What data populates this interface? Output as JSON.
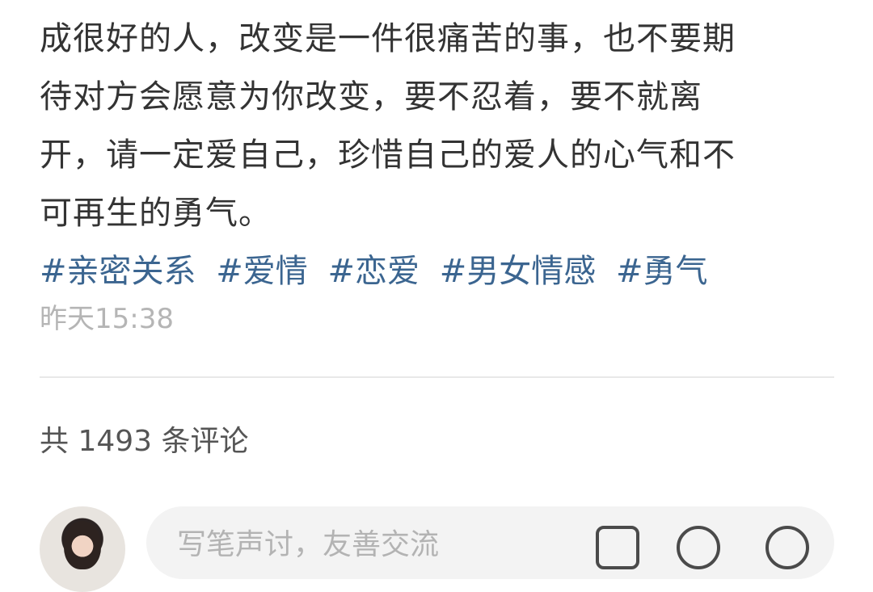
{
  "post": {
    "lines": [
      "成很好的人，改变是一件很痛苦的事，也不要期",
      "待对方会愿意为你改变，要不忍着，要不就离",
      "开，请一定爱自己，珍惜自己的爱人的心气和不",
      "可再生的勇气。"
    ],
    "tags": [
      "#亲密关系",
      "#爱情",
      "#恋爱",
      "#男女情感",
      "#勇气"
    ],
    "timestamp": "昨天15:38"
  },
  "comments": {
    "count_text": "共 1493 条评论",
    "input_placeholder": "写笔声讨，友善交流"
  },
  "colors": {
    "text": "#333333",
    "tag": "#3b6590",
    "muted": "#b5b5b5",
    "divider": "#e8e8e8",
    "input_bg": "#f3f3f3"
  },
  "icons": {
    "avatar": "avatar",
    "image": "image-icon",
    "mention": "at-icon",
    "emoji": "emoji-icon"
  }
}
